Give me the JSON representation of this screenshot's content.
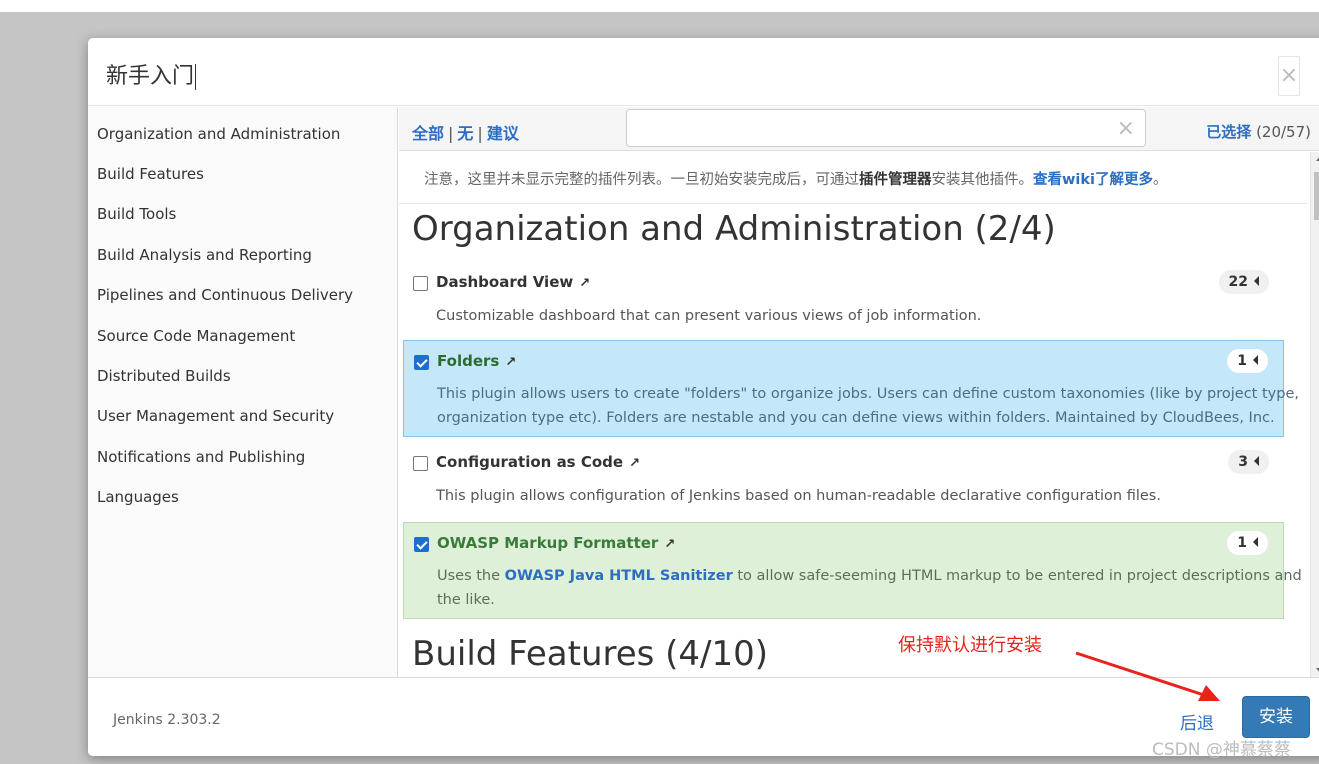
{
  "modal": {
    "title": "新手入门",
    "close_label": "×"
  },
  "sidebar": {
    "items": [
      {
        "label": "Organization and Administration"
      },
      {
        "label": "Build Features"
      },
      {
        "label": "Build Tools"
      },
      {
        "label": "Build Analysis and Reporting"
      },
      {
        "label": "Pipelines and Continuous Delivery"
      },
      {
        "label": "Source Code Management"
      },
      {
        "label": "Distributed Builds"
      },
      {
        "label": "User Management and Security"
      },
      {
        "label": "Notifications and Publishing"
      },
      {
        "label": "Languages"
      }
    ]
  },
  "toolbar": {
    "all_label": "全部",
    "none_label": "无",
    "suggested_label": "建议",
    "separator": "|",
    "search_value": "",
    "search_clear": "×",
    "selected_label": "已选择",
    "selected_count": "(20/57)"
  },
  "notice": {
    "prefix": "注意，这里并未显示完整的插件列表。一旦初始安装完成后，可通过",
    "plugin_manager": "插件管理器",
    "middle": "安装其他插件。",
    "wiki_link": "查看wiki了解更多",
    "suffix": "。"
  },
  "categories": [
    {
      "title": "Organization and Administration (2/4)"
    },
    {
      "title": "Build Features (4/10)"
    }
  ],
  "plugins": [
    {
      "name": "Dashboard View",
      "checked": false,
      "deps": "22",
      "description": "Customizable dashboard that can present various views of job information."
    },
    {
      "name": "Folders",
      "checked": true,
      "deps": "1",
      "description_line1": "This plugin allows users to create \"folders\" to organize jobs. Users can define custom taxonomies (like by project type,",
      "description_line2": "organization type etc). Folders are nestable and you can define views within folders. Maintained by CloudBees, Inc."
    },
    {
      "name": "Configuration as Code",
      "checked": false,
      "deps": "3",
      "description": "This plugin allows configuration of Jenkins based on human-readable declarative configuration files."
    },
    {
      "name": "OWASP Markup Formatter",
      "checked": true,
      "deps": "1",
      "description_prefix": "Uses the ",
      "description_link": "OWASP Java HTML Sanitizer",
      "description_suffix": " to allow safe-seeming HTML markup to be entered in project descriptions and",
      "description_line2": "the like."
    }
  ],
  "external_link_icon": "↗",
  "footer": {
    "version": "Jenkins 2.303.2",
    "back_label": "后退",
    "install_label": "安装"
  },
  "annotation": {
    "text": "保持默认进行安装",
    "color": "#e8231c"
  },
  "watermark": "CSDN @神慕蔡蔡",
  "colors": {
    "link": "#2b6ec3",
    "primary_button": "#337ab7",
    "selected_blue": "#c4e8fa",
    "selected_green": "#dff0d8"
  }
}
